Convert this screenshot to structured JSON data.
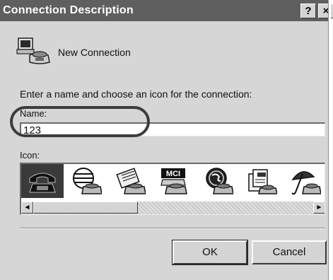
{
  "window": {
    "title": "Connection Description",
    "help_label": "?",
    "close_label": "×"
  },
  "header": {
    "connection_name": "New Connection",
    "icon": "new-connection-icon"
  },
  "instructions": "Enter a name and choose an icon for the connection:",
  "name_field": {
    "label": "Name:",
    "value": "123"
  },
  "icon_picker": {
    "label": "Icon:",
    "icons": [
      {
        "name": "phone-icon",
        "selected": true
      },
      {
        "name": "globe-phone-icon",
        "selected": false
      },
      {
        "name": "fax-phone-icon",
        "selected": false
      },
      {
        "name": "mci-phone-icon",
        "selected": false,
        "text": "MCI"
      },
      {
        "name": "ge-phone-icon",
        "selected": false
      },
      {
        "name": "documents-phone-icon",
        "selected": false
      },
      {
        "name": "umbrella-phone-icon",
        "selected": false
      }
    ],
    "scroll_left": "◄",
    "scroll_right": "►"
  },
  "buttons": {
    "ok": "OK",
    "cancel": "Cancel"
  }
}
